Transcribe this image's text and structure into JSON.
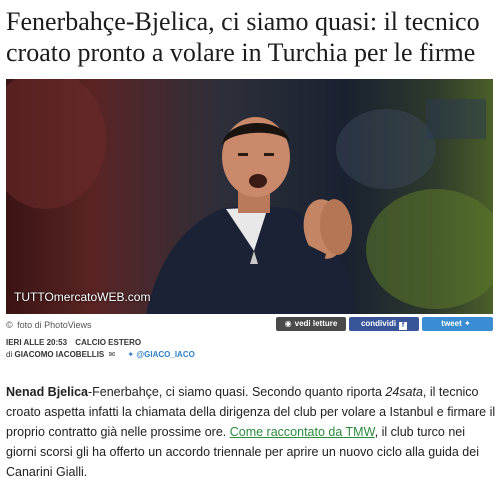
{
  "headline": "Fenerbahçe-Bjelica, ci siamo quasi: il tecnico croato pronto a volare in Turchia per le firme",
  "photo": {
    "watermark": "TUTTOmercatoWEB.com",
    "credit_prefix": "©",
    "credit": "foto di PhotoViews"
  },
  "buttons": {
    "views": "vedi letture",
    "share": "condividi",
    "tweet": "tweet"
  },
  "meta": {
    "timestamp": "IERI ALLE 20:53",
    "category": "CALCIO ESTERO",
    "by": "di",
    "author": "GIACOMO IACOBELLIS",
    "twitter": "@GIACO_IACO"
  },
  "article": {
    "name": "Nenad Bjelica",
    "part1": "-Fenerbahçe, ci siamo quasi. Secondo quanto riporta ",
    "source": "24sata",
    "part2": ", il tecnico croato aspetta infatti la chiamata della dirigenza del club per volare a Istanbul e firmare il proprio contratto già nelle prossime ore. ",
    "link": "Come raccontato da TMW",
    "part3": ", il club turco nei giorni scorsi gli ha offerto un accordo triennale per aprire un nuovo ciclo alla guida dei Canarini Gialli."
  },
  "colors": {
    "share": "#39559a",
    "tweet": "#3a8dd3",
    "views": "#4a4a4a",
    "link": "#2a8a3d"
  }
}
